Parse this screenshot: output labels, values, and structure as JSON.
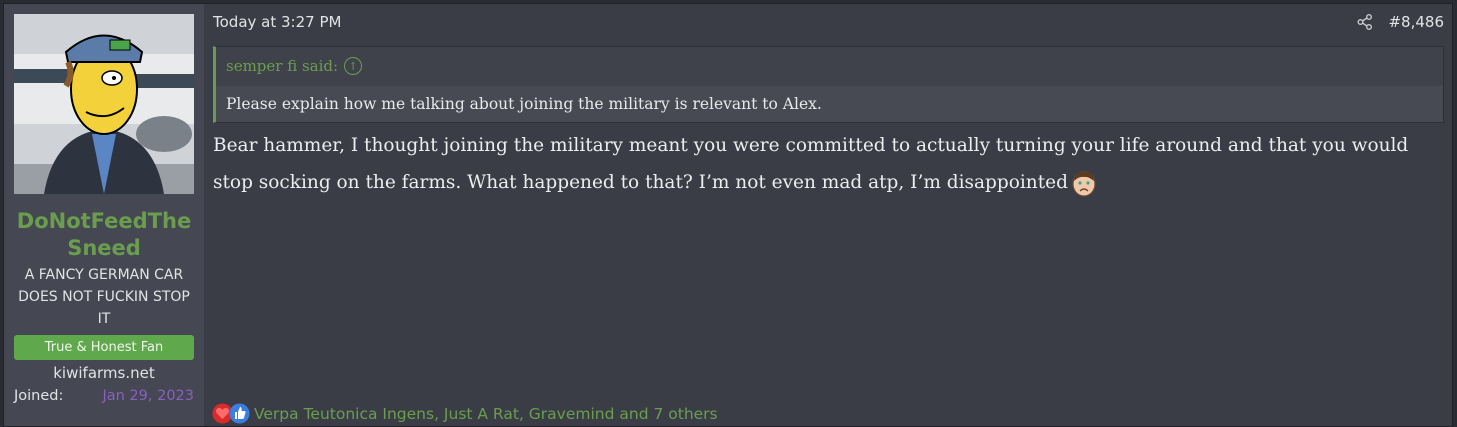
{
  "post": {
    "timestamp": "Today at 3:27 PM",
    "number": "#8,486",
    "icons": {
      "share": "share-icon",
      "quote_up": "arrow-up-circle-icon"
    }
  },
  "user": {
    "username": "DoNotFeedTheSneed",
    "title": "A FANCY GERMAN CAR DOES NOT FUCKIN STOP IT",
    "badge": "True & Honest Fan",
    "site": "kiwifarms.net",
    "joined_label": "Joined:",
    "joined_value": "Jan 29, 2023"
  },
  "quote": {
    "author": "semper fi said:",
    "text": "Please explain how me talking about joining the military is relevant to Alex."
  },
  "message": {
    "text": "Bear hammer, I thought joining the military meant you were committed to actually turning your life around and that you would stop socking on the farms. What happened to that? I’m not even mad atp, I’m disappointed",
    "emoji": "disappointed-face-icon"
  },
  "reactions": {
    "icons": [
      "heart-icon",
      "thumbs-up-icon"
    ],
    "text": "Verpa Teutonica Ingens, Just A Rat, Gravemind and 7 others"
  },
  "colors": {
    "accent_green": "#6a9e4e",
    "badge_green": "#5fa84b",
    "joined_purple": "#8a5fc4",
    "background": "#3a3d45"
  }
}
